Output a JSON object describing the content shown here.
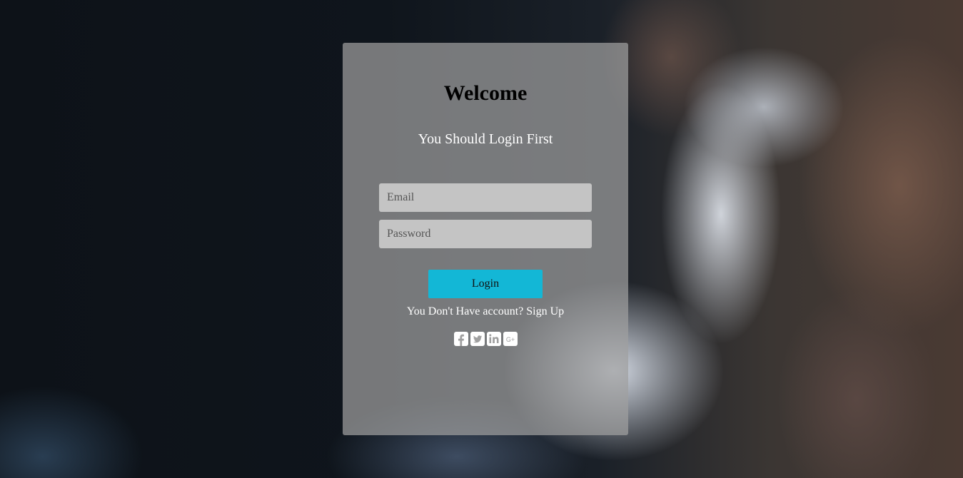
{
  "login": {
    "title": "Welcome",
    "subtitle": "You Should Login First",
    "email_placeholder": "Email",
    "password_placeholder": "Password",
    "login_label": "Login",
    "signup_prompt": "You Don't Have account? ",
    "signup_link": "Sign Up"
  },
  "social": {
    "icons": [
      "facebook-icon",
      "twitter-icon",
      "linkedin-icon",
      "google-plus-icon"
    ],
    "google_plus_text": "G+"
  },
  "colors": {
    "accent": "#13b7d6",
    "card": "#a0a0a0",
    "input": "#c4c4c4"
  }
}
